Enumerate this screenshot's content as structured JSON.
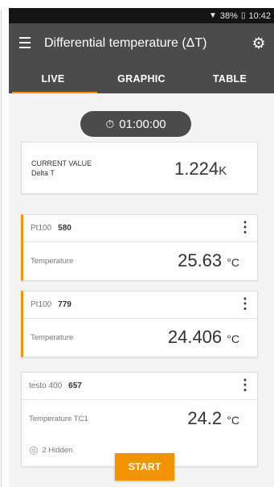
{
  "status": {
    "battery": "38%",
    "time": "10:42"
  },
  "appbar": {
    "title": "Differential temperature (ΔT)"
  },
  "tabs": [
    {
      "label": "LIVE",
      "active": true
    },
    {
      "label": "GRAPHIC",
      "active": false
    },
    {
      "label": "TABLE",
      "active": false
    }
  ],
  "timer": {
    "value": "01:00:00"
  },
  "current": {
    "label1": "CURRENT VALUE",
    "label2": "Delta T",
    "value": "1.224",
    "unit": "K"
  },
  "probes": [
    {
      "type": "Pt100",
      "serial": "580",
      "measure": "Temperature",
      "value": "25.63",
      "unit": "°C"
    },
    {
      "type": "Pt100",
      "serial": "779",
      "measure": "Temperature",
      "value": "24.406",
      "unit": "°C"
    },
    {
      "type": "testo 400",
      "serial": "657",
      "measure": "Temperature TC1",
      "value": "24.2",
      "unit": "°C",
      "hidden": "2 Hidden"
    }
  ],
  "start_label": "START",
  "colors": {
    "accent": "#f29400",
    "bar": "#4b4b4b"
  }
}
